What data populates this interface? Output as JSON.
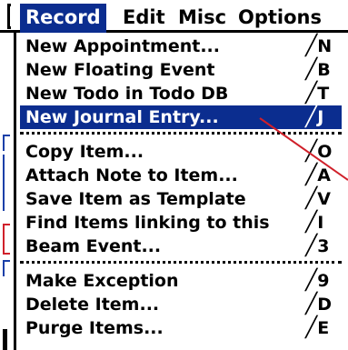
{
  "menubar": {
    "menus": [
      {
        "label": "Record",
        "active": true
      },
      {
        "label": "Edit",
        "active": false
      },
      {
        "label": "Misc",
        "active": false
      },
      {
        "label": "Options",
        "active": false
      }
    ]
  },
  "menu": {
    "groups": [
      [
        {
          "label": "New Appointment...",
          "shortcut": "N",
          "selected": false
        },
        {
          "label": "New Floating Event",
          "shortcut": "B",
          "selected": false
        },
        {
          "label": "New Todo in Todo DB",
          "shortcut": "T",
          "selected": false
        },
        {
          "label": "New Journal Entry...",
          "shortcut": "J",
          "selected": true
        }
      ],
      [
        {
          "label": "Copy Item...",
          "shortcut": "O",
          "selected": false
        },
        {
          "label": "Attach Note to Item...",
          "shortcut": "A",
          "selected": false
        },
        {
          "label": "Save Item as Template",
          "shortcut": "V",
          "selected": false
        },
        {
          "label": "Find Items linking to this",
          "shortcut": "I",
          "selected": false
        },
        {
          "label": "Beam Event...",
          "shortcut": "3",
          "selected": false
        }
      ],
      [
        {
          "label": "Make Exception",
          "shortcut": "9",
          "selected": false
        },
        {
          "label": "Delete Item...",
          "shortcut": "D",
          "selected": false
        },
        {
          "label": "Purge Items...",
          "shortcut": "E",
          "selected": false
        }
      ]
    ],
    "shortcut_stroke": "╱"
  },
  "colors": {
    "highlight": "#0b2d8f",
    "pointer_line": "#d0202a",
    "background_marks": "#1a3fa8"
  }
}
